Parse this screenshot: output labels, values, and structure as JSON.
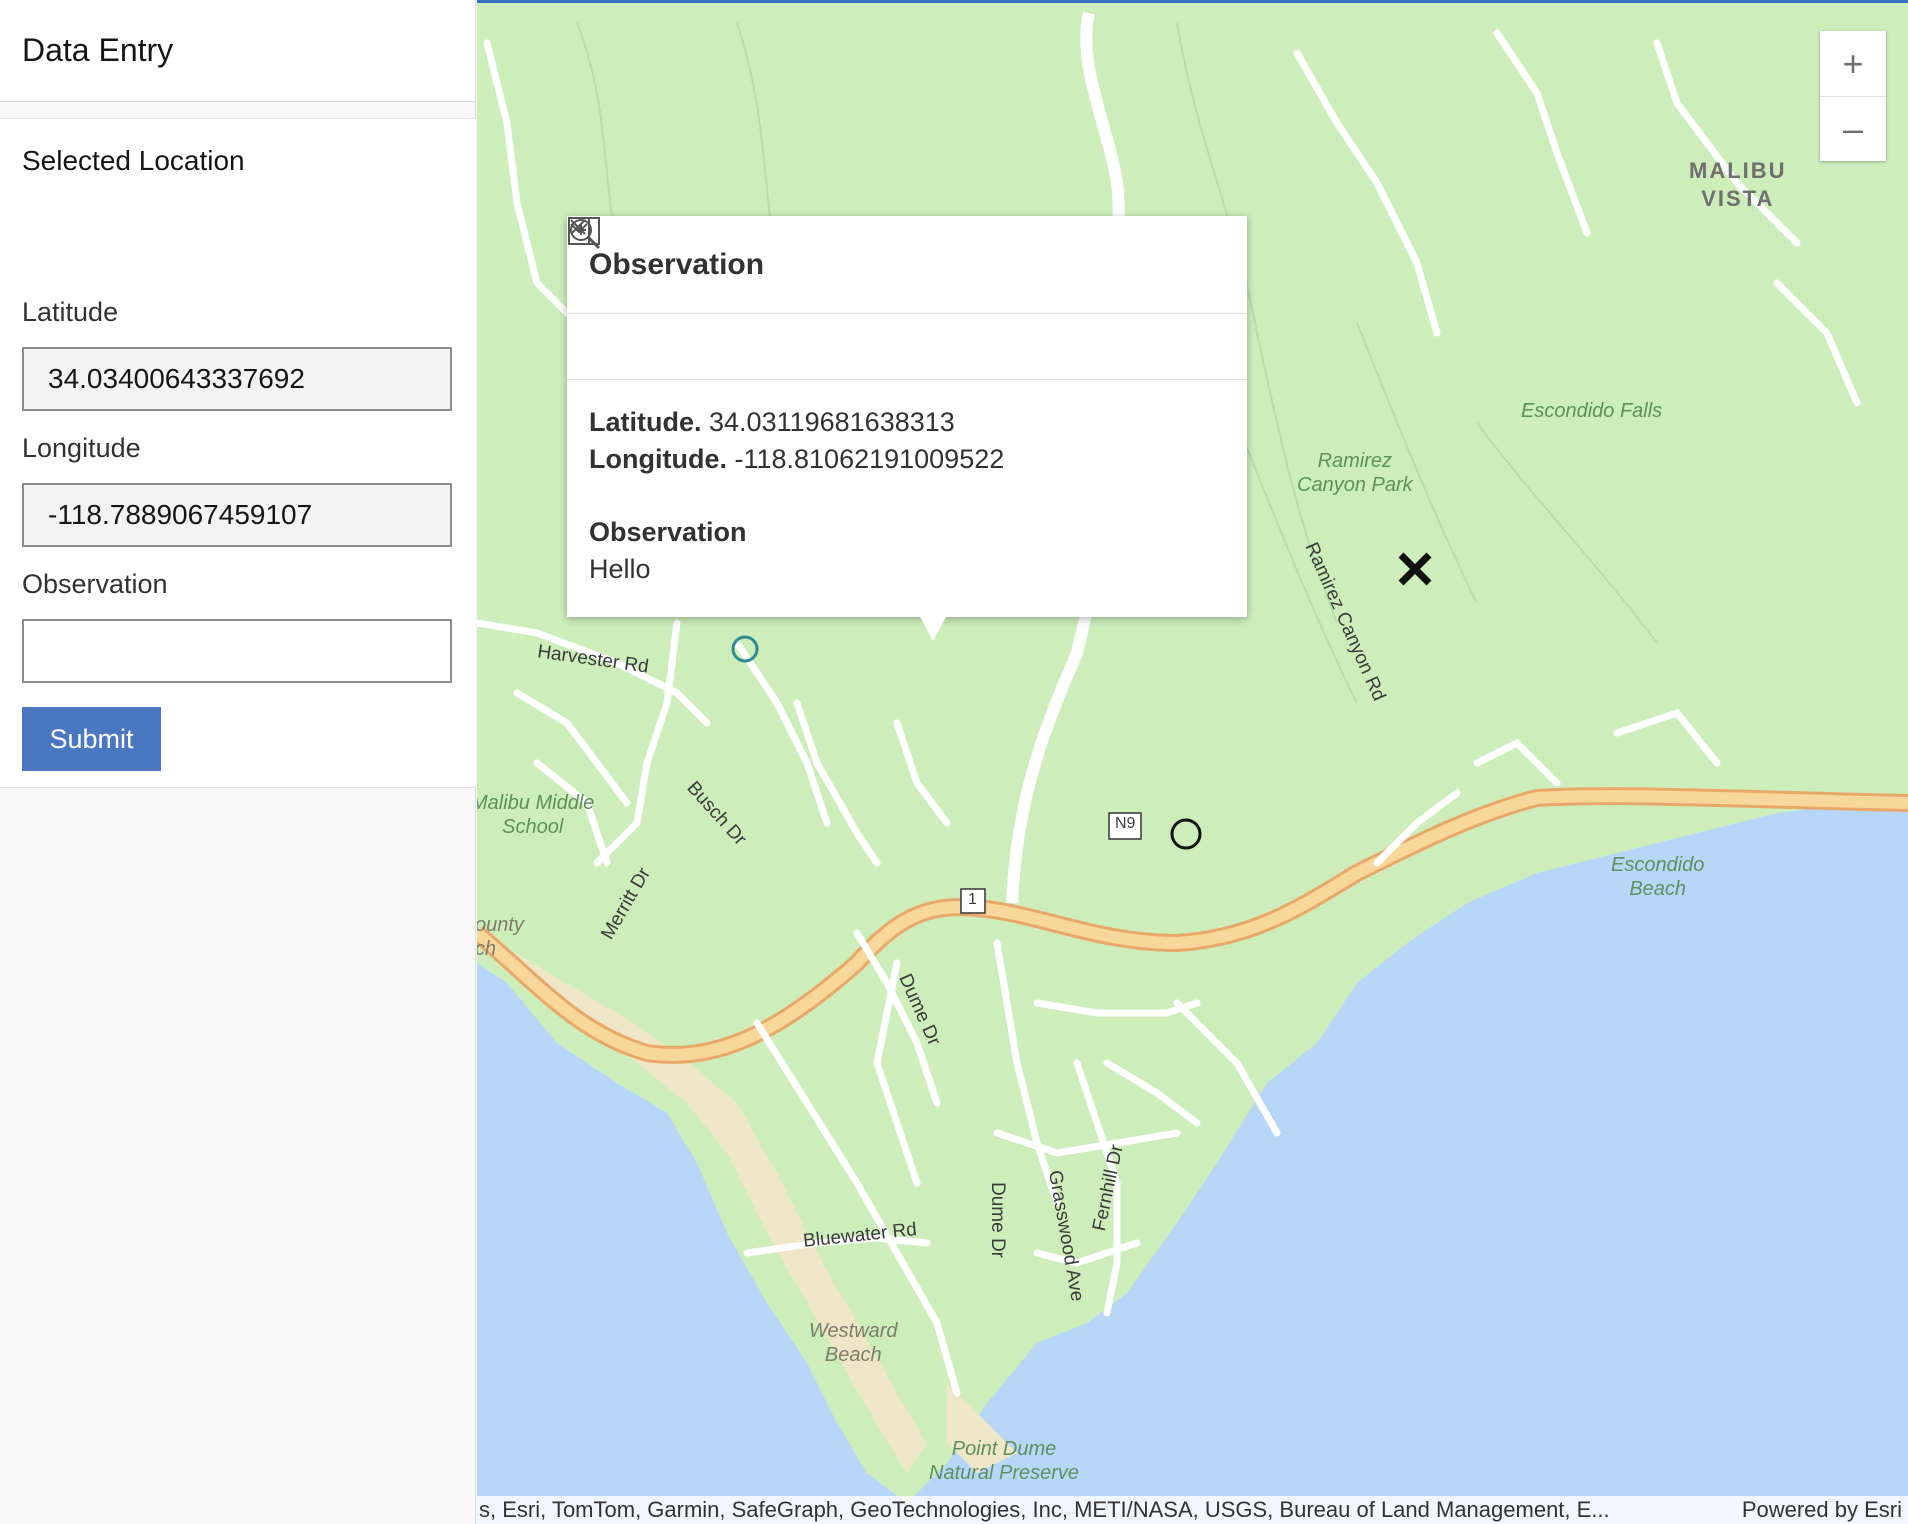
{
  "app": {
    "title": "Data Entry"
  },
  "panel": {
    "title": "Selected Location",
    "collapse_icon": "chevron-up-icon",
    "fields": {
      "latitude_label": "Latitude",
      "latitude_value": "34.03400643337692",
      "longitude_label": "Longitude",
      "longitude_value": "-118.7889067459107",
      "observation_label": "Observation",
      "observation_value": ""
    },
    "submit_label": "Submit"
  },
  "popup": {
    "title": "Observation",
    "dock_icon": "dock-icon",
    "collapse_icon": "chevron-down-icon",
    "close_icon": "close-icon",
    "zoom_icon": "zoom-to-icon",
    "lat_label": "Latitude.",
    "lat_value": "34.03119681638313",
    "lon_label": "Longitude.",
    "lon_value": "-118.81062191009522",
    "obs_label": "Observation",
    "obs_value": "Hello"
  },
  "map": {
    "zoom_in": "+",
    "zoom_out": "–",
    "place_labels": {
      "malibu_vista_1": "MALIBU",
      "malibu_vista_2": "VISTA",
      "escondido_falls": "Escondido Falls",
      "ramirez_1": "Ramirez",
      "ramirez_2": "Canyon Park",
      "escondido_beach_1": "Escondido",
      "escondido_beach_2": "Beach",
      "malibu_middle_1": "Malibu Middle",
      "malibu_middle_2": "School",
      "westward_1": "Westward",
      "westward_2": "Beach",
      "point_dume_1": "Point Dume",
      "point_dume_2": "Natural Preserve",
      "county_1": "ounty",
      "county_2": "ch"
    },
    "road_labels": {
      "harvester": "Harvester Rd",
      "busch": "Busch Dr",
      "merritt": "Merritt Dr",
      "dume_1": "Dume Dr",
      "dume_2": "Dume Dr",
      "grasswood": "Grasswood Ave",
      "fernhill": "Fernhill Dr",
      "bluewater": "Bluewater Rd",
      "ramirez_rd": "Ramirez Canyon Rd",
      "shield_n9": "N9",
      "shield_1": "1"
    },
    "attribution": "s, Esri, TomTom, Garmin, SafeGraph, GeoTechnologies, Inc, METI/NASA, USGS, Bureau of Land Management, E...",
    "powered_by": "Powered by Esri",
    "colors": {
      "land": "#cdeebb",
      "water": "#b8d7f8",
      "beach": "#efe6c8",
      "highway": "#f8d79a",
      "highway_edge": "#e9a86a",
      "road": "#ffffff"
    }
  }
}
